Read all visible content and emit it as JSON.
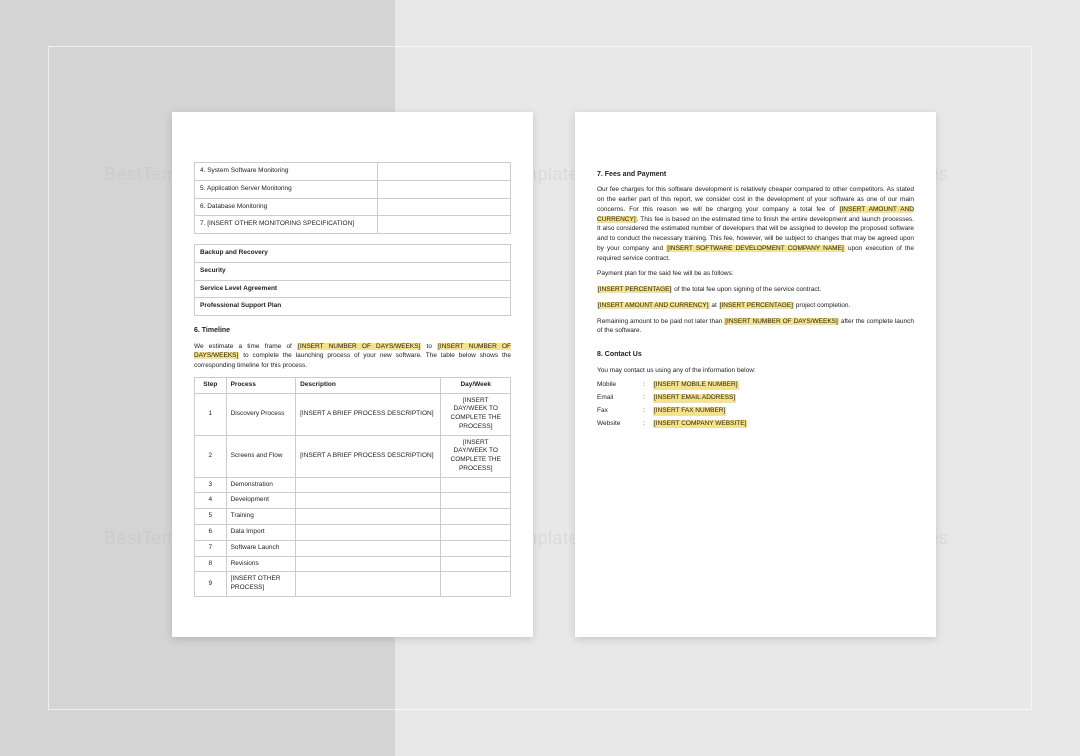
{
  "watermark": "BestTemplates",
  "page1": {
    "monitoring": [
      "4. System Software Monitoring",
      "5. Application Server Monitoring",
      "6. Database Monitoring",
      "7. [INSERT OTHER MONITORING SPECIFICATION]"
    ],
    "support": [
      "Backup and Recovery",
      "Security",
      "Service Level Agreement",
      "Professional Support Plan"
    ],
    "s6_title": "6.   Timeline",
    "s6_text_a": "We estimate a time frame of ",
    "s6_ph1": "[INSERT NUMBER OF DAYS/WEEKS]",
    "s6_mid": " to ",
    "s6_ph2": "[INSERT NUMBER OF DAYS/WEEKS]",
    "s6_text_b": " to complete the launching process of your new software. The table below shows the corresponding timeline for this process.",
    "timeline_headers": {
      "step": "Step",
      "process": "Process",
      "description": "Description",
      "day": "Day/Week"
    },
    "timeline": [
      {
        "n": "1",
        "p": "Discovery Process",
        "d": "[INSERT A BRIEF PROCESS DESCRIPTION]",
        "w": "[INSERT DAY/WEEK TO COMPLETE THE PROCESS]"
      },
      {
        "n": "2",
        "p": "Screens and Flow",
        "d": "[INSERT A BRIEF PROCESS DESCRIPTION]",
        "w": "[INSERT DAY/WEEK TO COMPLETE THE PROCESS]"
      },
      {
        "n": "3",
        "p": "Demonstration",
        "d": "",
        "w": ""
      },
      {
        "n": "4",
        "p": "Development",
        "d": "",
        "w": ""
      },
      {
        "n": "5",
        "p": "Training",
        "d": "",
        "w": ""
      },
      {
        "n": "6",
        "p": "Data Import",
        "d": "",
        "w": ""
      },
      {
        "n": "7",
        "p": "Software Launch",
        "d": "",
        "w": ""
      },
      {
        "n": "8",
        "p": "Revisions",
        "d": "",
        "w": ""
      },
      {
        "n": "9",
        "p": "[INSERT OTHER PROCESS]",
        "d": "",
        "w": ""
      }
    ]
  },
  "page2": {
    "s7_title": "7.   Fees and Payment",
    "p1a": "Our fee charges for this software development is relatively cheaper compared to other competitors. As stated on the earlier part of this report, we consider cost in the development of your software as one of our main concerns. For this reason we will be charging your company a total fee of ",
    "p1_ph1": "[INSERT AMOUNT AND CURRENCY]",
    "p1b": ". This fee is based on the estimated time to finish the entire development and launch processes. It also considered the estimated number of developers that will be assigned to develop the proposed software and to conduct the necessary training. This fee, however, will be subject to changes that may be agreed upon by your company and ",
    "p1_ph2": "[INSERT SOFTWARE DEVELOPMENT COMPANY NAME]",
    "p1c": " upon execution of the required service contract.",
    "p2": "Payment plan for the said fee will be as follows:",
    "p3_ph": "[INSERT PERCENTAGE]",
    "p3_rest": " of the total fee upon signing of the service contract.",
    "p4_ph1": "[INSERT AMOUNT AND CURRENCY]",
    "p4_mid": " at ",
    "p4_ph2": "[INSERT PERCENTAGE]",
    "p4_rest": " project completion.",
    "p5a": "Remaining amount to be paid not later than ",
    "p5_ph": "[INSERT NUMBER OF DAYS/WEEKS]",
    "p5b": " after the complete launch of the software.",
    "s8_title": "8.   Contact Us",
    "s8_intro": "You may contact us using any of the information below:",
    "contacts": {
      "mobile": {
        "label": "Mobile",
        "value": "[INSERT MOBILE NUMBER]"
      },
      "email": {
        "label": "Email",
        "value": "[INSERT EMAIL ADDRESS]"
      },
      "fax": {
        "label": "Fax",
        "value": "[INSERT FAX NUMBER]"
      },
      "website": {
        "label": "Website",
        "value": "[INSERT COMPANY WEBSITE]"
      }
    }
  }
}
